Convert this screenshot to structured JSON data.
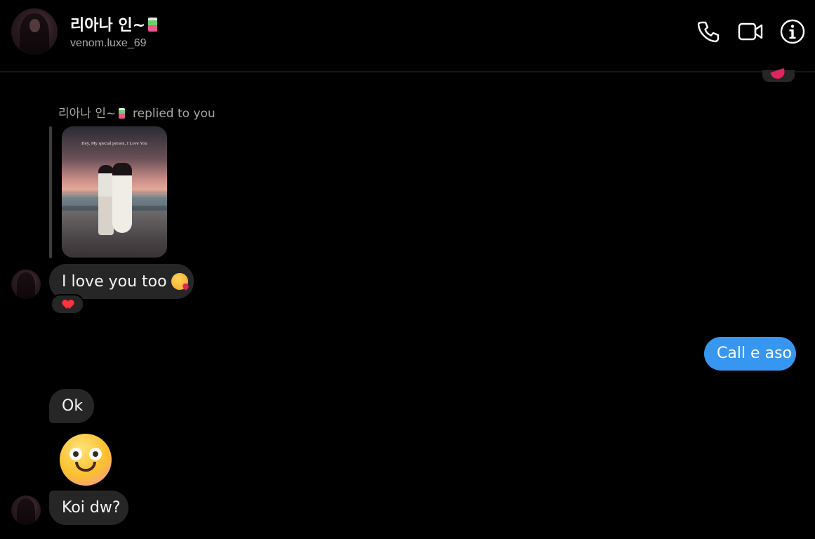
{
  "header": {
    "name": "리아나 인~",
    "handle": "venom.luxe_69",
    "actions": [
      "phone-icon",
      "video-icon",
      "info-icon"
    ]
  },
  "reply_context": {
    "name": "리아나 인~",
    "label": "replied to you",
    "story_caption": "Hey, My special person, I Love You"
  },
  "messages": [
    {
      "id": "m1",
      "direction": "incoming",
      "text": "I love you too",
      "emoji": "kissing-face-icon",
      "reaction": "heart-icon"
    },
    {
      "id": "m2",
      "direction": "outgoing",
      "text": "Call e aso"
    },
    {
      "id": "m3",
      "direction": "incoming",
      "text": "Ok"
    },
    {
      "id": "m4",
      "direction": "incoming",
      "emoji": "smiling-face-big-emoji"
    },
    {
      "id": "m5",
      "direction": "incoming",
      "text": "Koi dw?"
    }
  ],
  "colors": {
    "background": "#000000",
    "incoming_bubble": "#262626",
    "outgoing_bubble": "#3797f0",
    "muted_text": "#a8a8a8"
  }
}
